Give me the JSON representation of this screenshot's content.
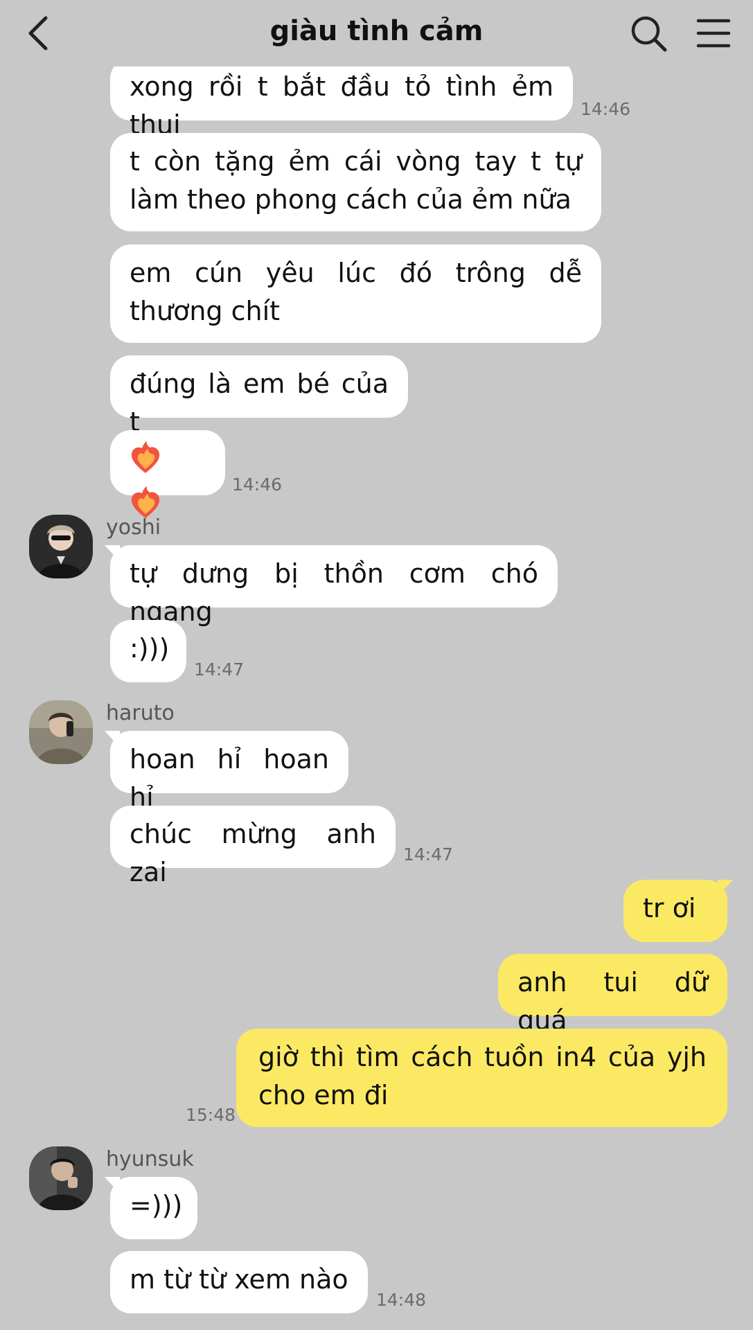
{
  "header": {
    "title": "giàu tình cảm",
    "back_icon": "chevron-left-icon",
    "search_icon": "search-icon",
    "menu_icon": "hamburger-menu-icon"
  },
  "colors": {
    "background": "#c8c8c8",
    "incoming_bubble": "#ffffff",
    "outgoing_bubble": "#fbe964"
  },
  "messages": {
    "m1": {
      "text": "xong rồi t bắt đầu tỏ tình ẻm thui",
      "time": "14:46"
    },
    "m2": {
      "text": "t còn tặng ẻm cái vòng tay t tự làm theo phong cách của ẻm nữa"
    },
    "m3": {
      "text": "em cún yêu lúc đó trông dễ thương chít"
    },
    "m4": {
      "text": "đúng là em bé của t"
    },
    "m5": {
      "emoji": "heart-on-fire-emoji x2",
      "time": "14:46"
    },
    "yoshi": {
      "name": "yoshi",
      "m1": {
        "text": "tự dưng bị thồn cơm chó ngang"
      },
      "m2": {
        "text": ":)))",
        "time": "14:47"
      }
    },
    "haruto": {
      "name": "haruto",
      "m1": {
        "text": "hoan hỉ hoan hỉ"
      },
      "m2": {
        "text": "chúc mừng anh zai",
        "time": "14:47"
      }
    },
    "me": {
      "m1": {
        "text": "tr ơi"
      },
      "m2": {
        "text": "anh tui dữ quá"
      },
      "m3": {
        "text": "giờ thì tìm cách tuồn in4 của yjh cho em đi",
        "time": "15:48"
      }
    },
    "hyunsuk": {
      "name": "hyunsuk",
      "m1": {
        "text": "=)))"
      },
      "m2": {
        "text": "m từ từ xem nào",
        "time": "14:48"
      }
    }
  }
}
